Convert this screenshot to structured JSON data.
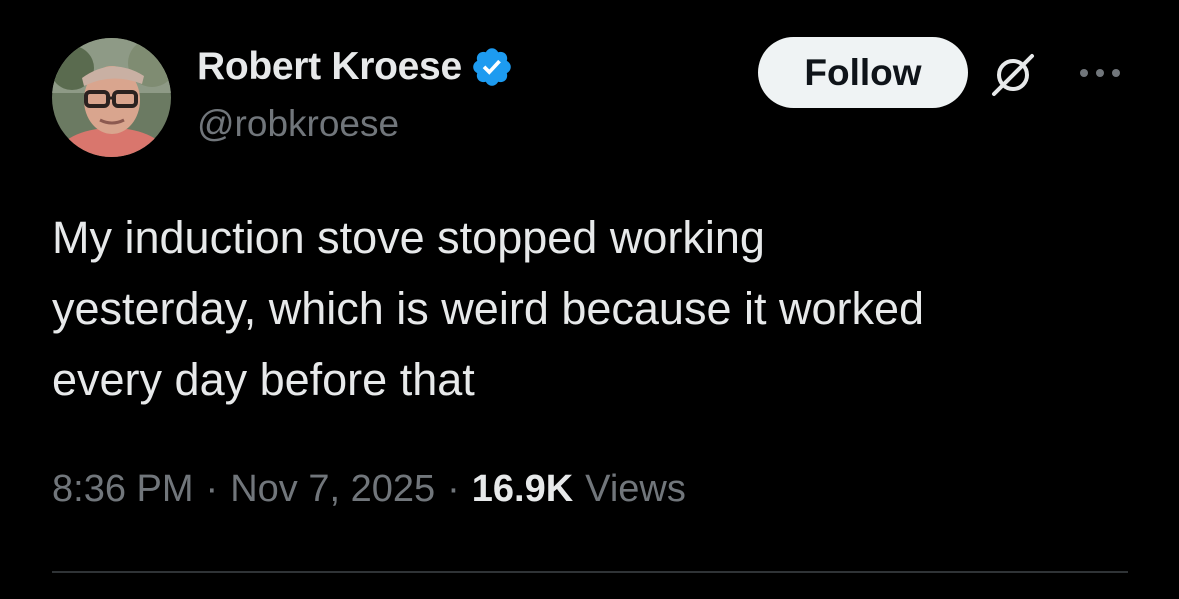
{
  "author": {
    "display_name": "Robert Kroese",
    "handle": "@robkroese",
    "verified": true
  },
  "actions": {
    "follow_label": "Follow",
    "grok_icon": "grok-icon",
    "more_icon": "more-options-icon"
  },
  "tweet": {
    "text": "My induction stove stopped working\nyesterday, which is weird because it worked\nevery day before that",
    "time": "8:36 PM",
    "date": "Nov 7, 2025",
    "separator": "·",
    "views_count": "16.9K",
    "views_label": "Views"
  },
  "colors": {
    "background": "#000000",
    "primary_text": "#e7e9ea",
    "secondary_text": "#71767b",
    "verified_badge": "#1d9bf0",
    "follow_button_bg": "#eff3f4",
    "divider": "#2f3336"
  }
}
